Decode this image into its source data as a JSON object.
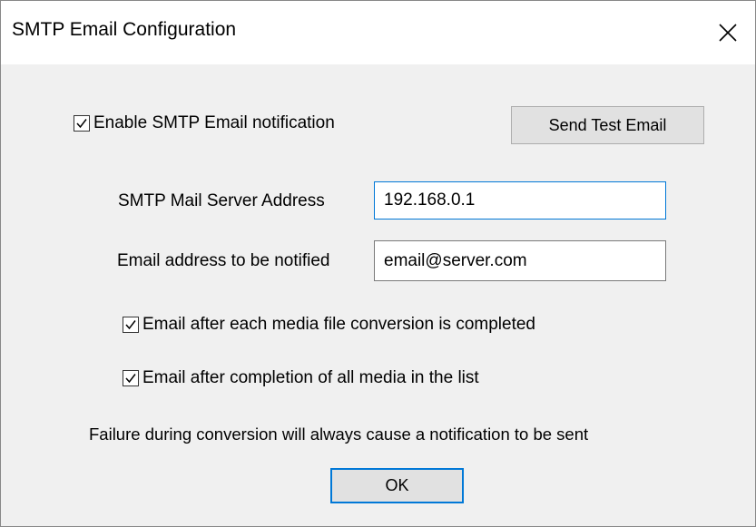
{
  "dialog": {
    "title": "SMTP Email Configuration",
    "close_icon": "close-icon"
  },
  "options": {
    "enable_smtp": {
      "label": "Enable SMTP Email notification",
      "checked": true
    },
    "email_after_each": {
      "label": "Email after each media file conversion is completed",
      "checked": true
    },
    "email_after_all": {
      "label": "Email after completion of all media in the list",
      "checked": true
    }
  },
  "buttons": {
    "send_test_label": "Send Test Email",
    "ok_label": "OK"
  },
  "fields": {
    "server_label": "SMTP Mail Server Address",
    "server_value": "192.168.0.1",
    "email_label": "Email address to be notified",
    "email_value": "email@server.com"
  },
  "info": {
    "failure_note": "Failure during conversion will always cause a notification to be sent"
  },
  "colors": {
    "accent": "#0078d7",
    "dialog_bg": "#f0f0f0",
    "titlebar_bg": "#ffffff"
  }
}
